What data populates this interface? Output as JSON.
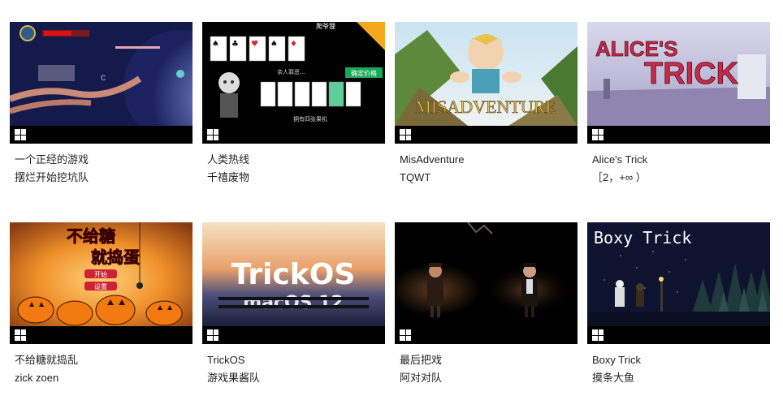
{
  "platform_icon": "windows-icon",
  "games": [
    {
      "title": "一个正经的游戏",
      "team": "摆烂开始挖坑队"
    },
    {
      "title": "人类热线",
      "team": "千禧废物",
      "art_text": [
        "爬爷狸",
        "拥有四张果机",
        "余人罪恶...",
        "确定价格"
      ]
    },
    {
      "title": "MisAdventure",
      "team": "TQWT",
      "art_text": [
        "MISADVENTURE"
      ]
    },
    {
      "title": "Alice's Trick",
      "team": "［2，+∞ ）",
      "art_text": [
        "ALICE'S",
        "TRICK"
      ]
    },
    {
      "title": "不给糖就捣乱",
      "team": "zick zoen",
      "art_text": [
        "不给糖",
        "就捣蛋",
        "开始",
        "设置"
      ]
    },
    {
      "title": "TrickOS",
      "team": "游戏果酱队",
      "art_text": [
        "TrickOS",
        "macOS 12"
      ]
    },
    {
      "title": "最后把戏",
      "team": "阿对对队"
    },
    {
      "title": "Boxy Trick",
      "team": "摸条大鱼",
      "art_text": [
        "Boxy Trick"
      ]
    }
  ]
}
